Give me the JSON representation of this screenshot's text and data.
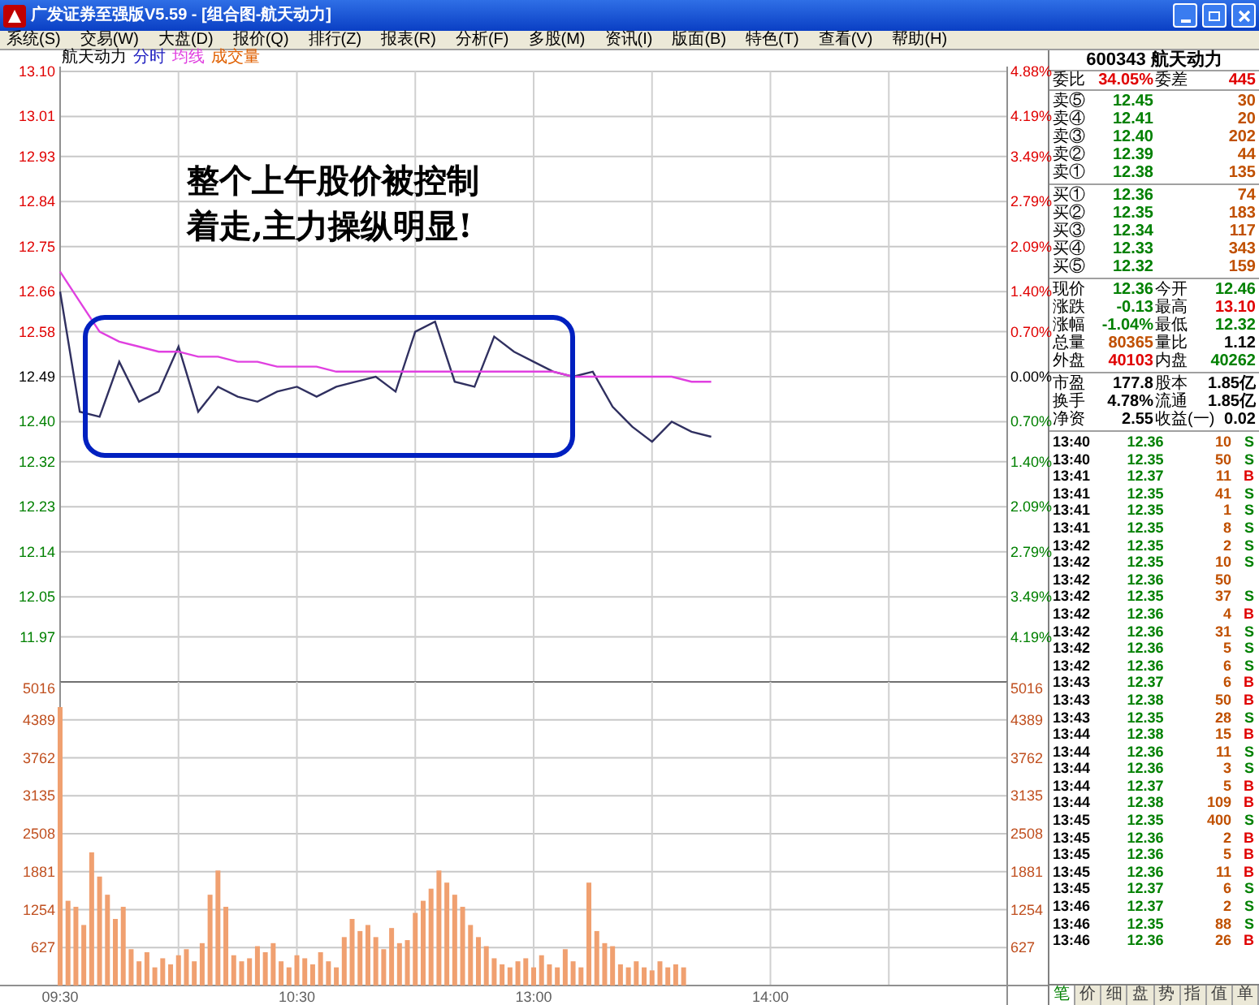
{
  "window": {
    "title": "广发证券至强版V5.59 - [组合图-航天动力]"
  },
  "menu": [
    "系统(S)",
    "交易(W)",
    "大盘(D)",
    "报价(Q)",
    "排行(Z)",
    "报表(R)",
    "分析(F)",
    "多股(M)",
    "资讯(I)",
    "版面(B)",
    "特色(T)",
    "查看(V)",
    "帮助(H)"
  ],
  "legend": [
    {
      "text": "航天动力",
      "kind": "name"
    },
    {
      "text": "成交量",
      "kind": "volume"
    }
  ],
  "price_chart": {
    "percent_labels": [
      {
        "text": "4.88%",
        "kind": "up"
      },
      {
        "text": "4.19%",
        "kind": "up"
      },
      {
        "text": "3.49%",
        "kind": "up"
      },
      {
        "text": "2.79%",
        "kind": "up"
      },
      {
        "text": "2.09%",
        "kind": "up"
      },
      {
        "text": "1.40%",
        "kind": "up"
      },
      {
        "text": "0.70%",
        "kind": "up"
      },
      {
        "text": "0.00%",
        "kind": "flat"
      },
      {
        "text": "0.70%",
        "kind": "down"
      },
      {
        "text": "1.40%",
        "kind": "down"
      },
      {
        "text": "2.09%",
        "kind": "down"
      },
      {
        "text": "2.79%",
        "kind": "down"
      },
      {
        "text": "3.49%",
        "kind": "down"
      },
      {
        "text": "4.19%",
        "kind": "down"
      }
    ],
    "chart_data": {
      "type": "line",
      "grid": true,
      "ylim": [
        11.88,
        13.1
      ],
      "categories": [
        null,
        null,
        null,
        null,
        null,
        null,
        null,
        null,
        null,
        null,
        null,
        null,
        null,
        null,
        null,
        null,
        null,
        null,
        null,
        null,
        null,
        null,
        null,
        null,
        null,
        null,
        null,
        null,
        null,
        null,
        null,
        null,
        null,
        null,
        null,
        null,
        null,
        null,
        null,
        null,
        null,
        null,
        null,
        null,
        null,
        null,
        null,
        null,
        null
      ],
      "series": [
        {
          "name": "分时",
          "color": "#303060",
          "values": [
            12.66,
            12.42,
            12.41,
            12.52,
            12.44,
            12.46,
            12.55,
            12.42,
            12.47,
            12.45,
            12.44,
            12.46,
            12.47,
            12.45,
            12.47,
            12.48,
            12.49,
            12.46,
            12.58,
            12.6,
            12.48,
            12.47,
            12.57,
            12.54,
            12.52,
            12.5,
            12.49,
            12.5,
            12.43,
            12.39,
            12.36,
            12.4,
            12.38,
            12.37,
            null,
            null,
            null,
            null,
            null,
            null,
            null,
            null,
            null,
            null,
            null,
            null,
            null,
            null,
            null
          ]
        },
        {
          "name": "均线",
          "color": "#e040e0",
          "values": [
            12.7,
            12.64,
            12.58,
            12.56,
            12.55,
            12.54,
            12.54,
            12.53,
            12.53,
            12.52,
            12.52,
            12.51,
            12.51,
            12.51,
            12.5,
            12.5,
            12.5,
            12.5,
            12.5,
            12.5,
            12.5,
            12.5,
            12.5,
            12.5,
            12.5,
            12.5,
            12.49,
            12.49,
            12.49,
            12.49,
            12.49,
            12.49,
            12.48,
            12.48,
            null,
            null,
            null,
            null,
            null,
            null,
            null,
            null,
            null,
            null,
            null,
            null,
            null,
            null,
            null
          ]
        }
      ],
      "yticks": [
        {
          "value": 13.1,
          "label": "13.10"
        },
        {
          "value": 13.01,
          "label": "13.01"
        },
        {
          "value": 12.93,
          "label": "12.93"
        },
        {
          "value": 12.84,
          "label": "12.84"
        },
        {
          "value": 12.75,
          "label": "12.75"
        },
        {
          "value": 12.66,
          "label": "12.66"
        },
        {
          "value": 12.58,
          "label": "12.58"
        },
        {
          "value": 12.49,
          "label": "12.49"
        },
        {
          "value": 12.4,
          "label": "12.40"
        },
        {
          "value": 12.32,
          "label": "12.32"
        },
        {
          "value": 12.23,
          "label": "12.23"
        },
        {
          "value": 12.14,
          "label": "12.14"
        },
        {
          "value": 12.05,
          "label": "12.05"
        },
        {
          "value": 11.97,
          "label": "11.97"
        }
      ]
    }
  },
  "volume_chart": {
    "chart_data": {
      "type": "bar",
      "grid": true,
      "ylim": [
        0,
        5016
      ],
      "categories": [
        "09:30",
        null,
        null,
        null,
        null,
        null,
        null,
        null,
        null,
        null,
        null,
        null,
        null,
        null,
        null,
        null,
        null,
        null,
        null,
        null,
        null,
        null,
        null,
        null,
        null,
        null,
        null,
        null,
        null,
        null,
        "10:30",
        null,
        null,
        null,
        null,
        null,
        null,
        null,
        null,
        null,
        null,
        null,
        null,
        null,
        null,
        null,
        null,
        null,
        null,
        null,
        null,
        null,
        null,
        null,
        null,
        null,
        null,
        null,
        null,
        null,
        "13:00",
        null,
        null,
        null,
        null,
        null,
        null,
        null,
        null,
        null,
        null,
        null,
        null,
        null,
        null,
        null,
        null,
        null,
        null,
        null,
        null,
        null,
        null,
        null,
        null,
        null,
        null,
        null,
        null,
        null,
        "14:00",
        null,
        null,
        null,
        null,
        null,
        null,
        null,
        null,
        null,
        null,
        null,
        null,
        null,
        null,
        null,
        null,
        null,
        null,
        null,
        null,
        null,
        null,
        null,
        null,
        null,
        null,
        null,
        null,
        null,
        null
      ],
      "values": [
        4600,
        1400,
        1300,
        1000,
        2200,
        1800,
        1500,
        1100,
        1300,
        600,
        400,
        550,
        300,
        450,
        350,
        500,
        600,
        400,
        700,
        1500,
        1900,
        1300,
        500,
        400,
        450,
        650,
        550,
        700,
        400,
        300,
        500,
        450,
        350,
        550,
        400,
        300,
        800,
        1100,
        900,
        1000,
        800,
        600,
        950,
        700,
        750,
        1200,
        1400,
        1600,
        1900,
        1700,
        1500,
        1300,
        1000,
        800,
        650,
        450,
        350,
        300,
        400,
        450,
        300,
        500,
        350,
        300,
        600,
        400,
        300,
        1700,
        900,
        700,
        650,
        350,
        300,
        400,
        300,
        250,
        400,
        300,
        350,
        300,
        null,
        null,
        null,
        null,
        null,
        null,
        null,
        null,
        null,
        null,
        null,
        null,
        null,
        null,
        null,
        null,
        null,
        null,
        null,
        null,
        null,
        null,
        null,
        null,
        null,
        null,
        null,
        null,
        null,
        null,
        null,
        null,
        null,
        null,
        null,
        null,
        null,
        null,
        null,
        null,
        null
      ],
      "yticks": [
        {
          "value": 5016,
          "label": "5016"
        },
        {
          "value": 4389,
          "label": "4389"
        },
        {
          "value": 3762,
          "label": "3762"
        },
        {
          "value": 3135,
          "label": "3135"
        },
        {
          "value": 2508,
          "label": "2508"
        },
        {
          "value": 1881,
          "label": "1881"
        },
        {
          "value": 1254,
          "label": "1254"
        },
        {
          "value": 627,
          "label": "627"
        }
      ]
    }
  },
  "annotation": {
    "lines": [
      "整个上午股价被控制",
      "着走,主力操纵明显!"
    ]
  },
  "quote": {
    "header": "600343 航天动力",
    "ratio": [
      {
        "label": "委比",
        "value": "34.05%",
        "kind": "up"
      },
      {
        "label": "委差",
        "value": "445",
        "kind": "up"
      }
    ],
    "sells": [
      {
        "label": "卖⑤",
        "price": "12.45",
        "volume": "30"
      },
      {
        "label": "卖④",
        "price": "12.41",
        "volume": "20"
      },
      {
        "label": "卖③",
        "price": "12.40",
        "volume": "202"
      },
      {
        "label": "卖②",
        "price": "12.39",
        "volume": "44"
      },
      {
        "label": "卖①",
        "price": "12.38",
        "volume": "135"
      }
    ],
    "buys": [
      {
        "label": "买①",
        "price": "12.36",
        "volume": "74"
      },
      {
        "label": "买②",
        "price": "12.35",
        "volume": "183"
      },
      {
        "label": "买③",
        "price": "12.34",
        "volume": "117"
      },
      {
        "label": "买④",
        "price": "12.33",
        "volume": "343"
      },
      {
        "label": "买⑤",
        "price": "12.32",
        "volume": "159"
      }
    ],
    "stats": [
      {
        "label": "现价",
        "value": "12.36",
        "kind": "down"
      },
      {
        "label": "今开",
        "value": "12.46",
        "kind": "down"
      },
      {
        "label": "涨跌",
        "value": "-0.13",
        "kind": "down"
      },
      {
        "label": "最高",
        "value": "13.10",
        "kind": "up"
      },
      {
        "label": "涨幅",
        "value": "-1.04%",
        "kind": "down"
      },
      {
        "label": "最低",
        "value": "12.32",
        "kind": "down"
      },
      {
        "label": "总量",
        "value": "80365",
        "kind": "volume"
      },
      {
        "label": "量比",
        "value": "1.12",
        "kind": "flat"
      },
      {
        "label": "外盘",
        "value": "40103",
        "kind": "up"
      },
      {
        "label": "内盘",
        "value": "40262",
        "kind": "down"
      }
    ],
    "fundamentals": [
      {
        "label": "市盈",
        "value": "177.8"
      },
      {
        "label": "股本",
        "value": "1.85亿"
      },
      {
        "label": "换手",
        "value": "4.78%"
      },
      {
        "label": "流通",
        "value": "1.85亿"
      },
      {
        "label": "净资",
        "value": "2.55"
      },
      {
        "label": "收益(一)",
        "value": "0.02"
      }
    ],
    "ticks": [
      {
        "time": "13:40",
        "price": "12.36",
        "volume": "10",
        "side": "S",
        "kind": "sell"
      },
      {
        "time": "13:40",
        "price": "12.35",
        "volume": "50",
        "side": "S",
        "kind": "sell"
      },
      {
        "time": "13:41",
        "price": "12.37",
        "volume": "11",
        "side": "B",
        "kind": "buy"
      },
      {
        "time": "13:41",
        "price": "12.35",
        "volume": "41",
        "side": "S",
        "kind": "sell"
      },
      {
        "time": "13:41",
        "price": "12.35",
        "volume": "1",
        "side": "S",
        "kind": "sell"
      },
      {
        "time": "13:41",
        "price": "12.35",
        "volume": "8",
        "side": "S",
        "kind": "sell"
      },
      {
        "time": "13:42",
        "price": "12.35",
        "volume": "2",
        "side": "S",
        "kind": "sell"
      },
      {
        "time": "13:42",
        "price": "12.35",
        "volume": "10",
        "side": "S",
        "kind": "sell"
      },
      {
        "time": "13:42",
        "price": "12.36",
        "volume": "50",
        "kind": "none"
      },
      {
        "time": "13:42",
        "price": "12.35",
        "volume": "37",
        "side": "S",
        "kind": "sell"
      },
      {
        "time": "13:42",
        "price": "12.36",
        "volume": "4",
        "side": "B",
        "kind": "buy"
      },
      {
        "time": "13:42",
        "price": "12.36",
        "volume": "31",
        "side": "S",
        "kind": "sell"
      },
      {
        "time": "13:42",
        "price": "12.36",
        "volume": "5",
        "side": "S",
        "kind": "sell"
      },
      {
        "time": "13:42",
        "price": "12.36",
        "volume": "6",
        "side": "S",
        "kind": "sell"
      },
      {
        "time": "13:43",
        "price": "12.37",
        "volume": "6",
        "side": "B",
        "kind": "buy"
      },
      {
        "time": "13:43",
        "price": "12.38",
        "volume": "50",
        "side": "B",
        "kind": "buy"
      },
      {
        "time": "13:43",
        "price": "12.35",
        "volume": "28",
        "side": "S",
        "kind": "sell"
      },
      {
        "time": "13:44",
        "price": "12.38",
        "volume": "15",
        "side": "B",
        "kind": "buy"
      },
      {
        "time": "13:44",
        "price": "12.36",
        "volume": "11",
        "side": "S",
        "kind": "sell"
      },
      {
        "time": "13:44",
        "price": "12.36",
        "volume": "3",
        "side": "S",
        "kind": "sell"
      },
      {
        "time": "13:44",
        "price": "12.37",
        "volume": "5",
        "side": "B",
        "kind": "buy"
      },
      {
        "time": "13:44",
        "price": "12.38",
        "volume": "109",
        "side": "B",
        "kind": "buy"
      },
      {
        "time": "13:45",
        "price": "12.35",
        "volume": "400",
        "side": "S",
        "kind": "sell"
      },
      {
        "time": "13:45",
        "price": "12.36",
        "volume": "2",
        "side": "B",
        "kind": "buy"
      },
      {
        "time": "13:45",
        "price": "12.36",
        "volume": "5",
        "side": "B",
        "kind": "buy"
      },
      {
        "time": "13:45",
        "price": "12.36",
        "volume": "11",
        "side": "B",
        "kind": "buy"
      },
      {
        "time": "13:45",
        "price": "12.37",
        "volume": "6",
        "side": "S",
        "kind": "sell"
      },
      {
        "time": "13:46",
        "price": "12.37",
        "volume": "2",
        "side": "S",
        "kind": "sell"
      },
      {
        "time": "13:46",
        "price": "12.35",
        "volume": "88",
        "side": "S",
        "kind": "sell"
      },
      {
        "time": "13:46",
        "price": "12.36",
        "volume": "26",
        "side": "B",
        "kind": "buy"
      }
    ],
    "tabs": [
      {
        "label": "笔",
        "selected": true
      },
      {
        "label": "价",
        "selected": false
      },
      {
        "label": "细",
        "selected": false
      },
      {
        "label": "盘",
        "selected": false
      },
      {
        "label": "势",
        "selected": false
      },
      {
        "label": "指",
        "selected": false
      },
      {
        "label": "值",
        "selected": false
      },
      {
        "label": "单",
        "selected": false
      }
    ]
  }
}
